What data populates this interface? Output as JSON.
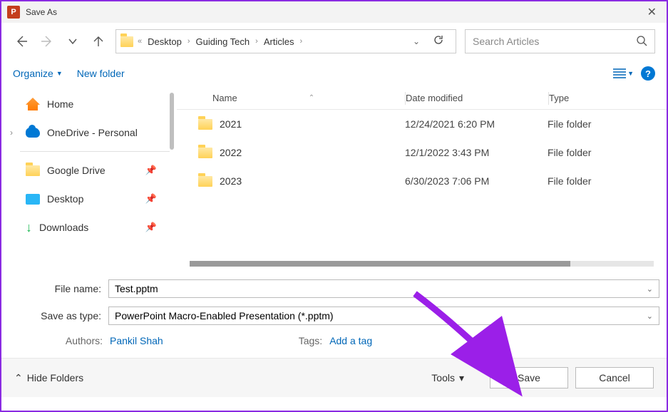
{
  "window": {
    "title": "Save As"
  },
  "nav": {
    "breadcrumbs": [
      "Desktop",
      "Guiding Tech",
      "Articles"
    ],
    "search_placeholder": "Search Articles"
  },
  "toolbar": {
    "organize": "Organize",
    "new_folder": "New folder"
  },
  "sidebar": {
    "home": "Home",
    "onedrive": "OneDrive - Personal",
    "google_drive": "Google Drive",
    "desktop": "Desktop",
    "downloads": "Downloads"
  },
  "columns": {
    "name": "Name",
    "date": "Date modified",
    "type": "Type"
  },
  "files": [
    {
      "name": "2021",
      "date": "12/24/2021 6:20 PM",
      "type": "File folder"
    },
    {
      "name": "2022",
      "date": "12/1/2022 3:43 PM",
      "type": "File folder"
    },
    {
      "name": "2023",
      "date": "6/30/2023 7:06 PM",
      "type": "File folder"
    }
  ],
  "form": {
    "file_name_label": "File name:",
    "file_name_value": "Test.pptm",
    "save_type_label": "Save as type:",
    "save_type_value": "PowerPoint Macro-Enabled Presentation (*.pptm)",
    "authors_label": "Authors:",
    "authors_value": "Pankil Shah",
    "tags_label": "Tags:",
    "tags_value": "Add a tag"
  },
  "footer": {
    "hide_folders": "Hide Folders",
    "tools": "Tools",
    "save": "Save",
    "cancel": "Cancel"
  }
}
